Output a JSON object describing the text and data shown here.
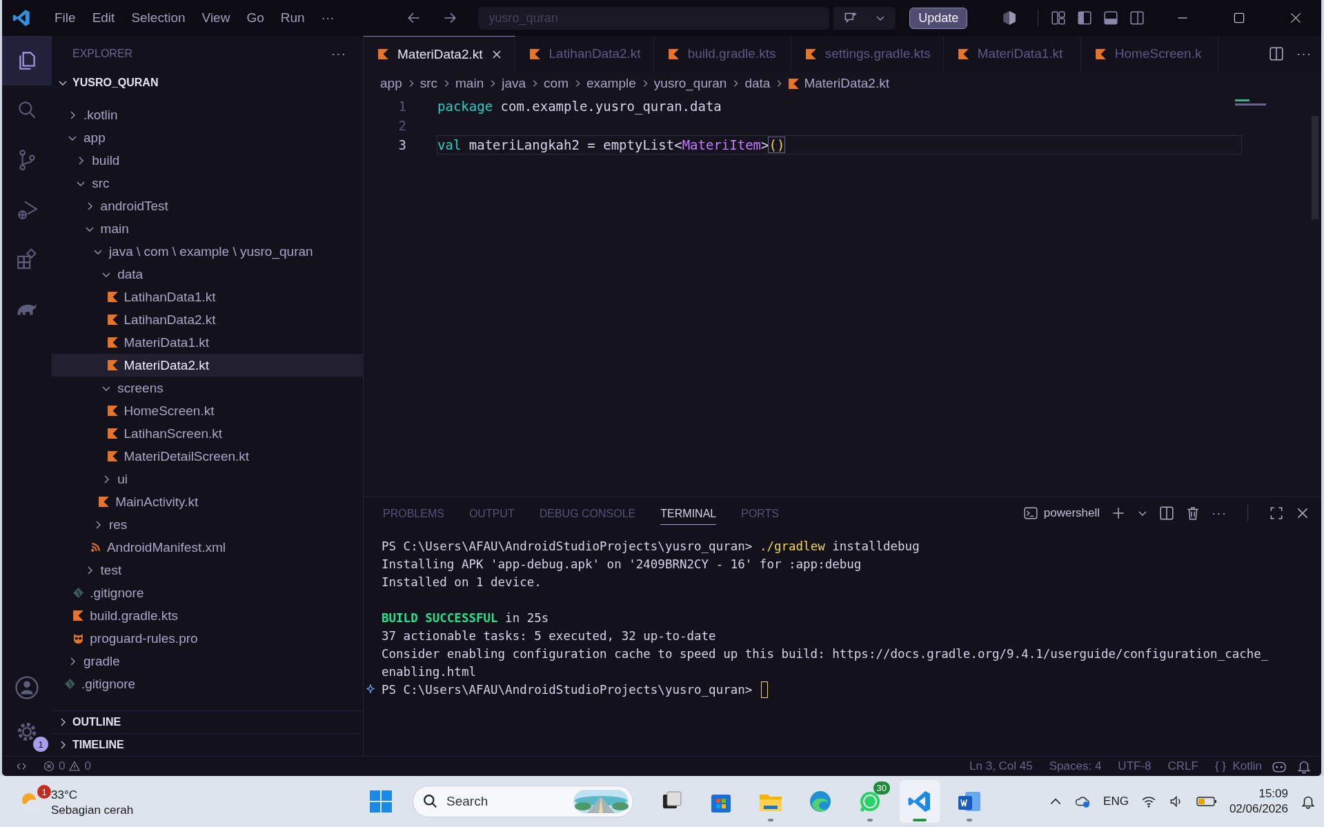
{
  "window": {
    "menu": [
      "File",
      "Edit",
      "Selection",
      "View",
      "Go",
      "Run",
      "···"
    ],
    "command_center": "yusro_quran",
    "update_button": "Update"
  },
  "activity_bar": {
    "items": [
      {
        "kind": "explorer",
        "selected": true
      },
      {
        "kind": "search",
        "selected": false
      },
      {
        "kind": "source-control",
        "selected": false
      },
      {
        "kind": "run-debug",
        "selected": false
      },
      {
        "kind": "extensions",
        "selected": false
      },
      {
        "kind": "gradle",
        "selected": false
      }
    ],
    "settings_badge": "1"
  },
  "explorer": {
    "title": "EXPLORER",
    "more": "···",
    "root": {
      "label": "YUSRO_QURAN",
      "expanded": true
    },
    "tree": [
      {
        "label": ".kotlin",
        "kind": "folder",
        "expanded": false,
        "selected": false
      },
      {
        "label": "app",
        "kind": "folder",
        "expanded": true,
        "selected": false,
        "children": [
          {
            "label": "build",
            "kind": "folder",
            "expanded": false,
            "selected": false
          },
          {
            "label": "src",
            "kind": "folder",
            "expanded": true,
            "selected": false,
            "children": [
              {
                "label": "androidTest",
                "kind": "folder",
                "expanded": false,
                "selected": false
              },
              {
                "label": "main",
                "kind": "folder",
                "expanded": true,
                "selected": false,
                "children": [
                  {
                    "label": "java \\ com \\ example \\ yusro_quran",
                    "kind": "folder",
                    "expanded": true,
                    "selected": false,
                    "children": [
                      {
                        "label": "data",
                        "kind": "folder",
                        "expanded": true,
                        "selected": false,
                        "children": [
                          {
                            "label": "LatihanData1.kt",
                            "kind": "kotlin",
                            "selected": false
                          },
                          {
                            "label": "LatihanData2.kt",
                            "kind": "kotlin",
                            "selected": false
                          },
                          {
                            "label": "MateriData1.kt",
                            "kind": "kotlin",
                            "selected": false
                          },
                          {
                            "label": "MateriData2.kt",
                            "kind": "kotlin",
                            "selected": true
                          }
                        ]
                      },
                      {
                        "label": "screens",
                        "kind": "folder",
                        "expanded": true,
                        "selected": false,
                        "children": [
                          {
                            "label": "HomeScreen.kt",
                            "kind": "kotlin",
                            "selected": false
                          },
                          {
                            "label": "LatihanScreen.kt",
                            "kind": "kotlin",
                            "selected": false
                          },
                          {
                            "label": "MateriDetailScreen.kt",
                            "kind": "kotlin",
                            "selected": false
                          }
                        ]
                      },
                      {
                        "label": "ui",
                        "kind": "folder",
                        "expanded": false,
                        "selected": false
                      },
                      {
                        "label": "MainActivity.kt",
                        "kind": "kotlin",
                        "selected": false
                      }
                    ]
                  },
                  {
                    "label": "res",
                    "kind": "folder",
                    "expanded": false,
                    "selected": false
                  },
                  {
                    "label": "AndroidManifest.xml",
                    "kind": "xml",
                    "selected": false
                  }
                ]
              },
              {
                "label": "test",
                "kind": "folder",
                "expanded": false,
                "selected": false
              }
            ]
          },
          {
            "label": ".gitignore",
            "kind": "git",
            "selected": false
          },
          {
            "label": "build.gradle.kts",
            "kind": "kotlin",
            "selected": false
          },
          {
            "label": "proguard-rules.pro",
            "kind": "proguard",
            "selected": false
          }
        ]
      },
      {
        "label": "gradle",
        "kind": "folder",
        "expanded": false,
        "selected": false
      },
      {
        "label": ".gitignore",
        "kind": "git",
        "selected": false
      }
    ],
    "sections": [
      {
        "label": "OUTLINE",
        "expanded": false
      },
      {
        "label": "TIMELINE",
        "expanded": false
      }
    ]
  },
  "editor": {
    "tabs": [
      {
        "label": "MateriData2.kt",
        "selected": true
      },
      {
        "label": "LatihanData2.kt",
        "selected": false
      },
      {
        "label": "build.gradle.kts",
        "selected": false
      },
      {
        "label": "settings.gradle.kts",
        "selected": false
      },
      {
        "label": "MateriData1.kt",
        "selected": false
      },
      {
        "label": "HomeScreen.k",
        "selected": false
      }
    ],
    "tab_more": "···",
    "breadcrumb": [
      "app",
      "src",
      "main",
      "java",
      "com",
      "example",
      "yusro_quran",
      "data",
      "MateriData2.kt"
    ],
    "lines": [
      {
        "number": "1",
        "selected": false,
        "tokens": [
          {
            "text": "package",
            "kind": "keyword"
          },
          {
            "text": " com.example.yusro_quran.data",
            "kind": "plain"
          }
        ]
      },
      {
        "number": "2",
        "selected": false
      },
      {
        "number": "3",
        "selected": true,
        "tokens": [
          {
            "text": "val",
            "kind": "keyword"
          },
          {
            "text": " materiLangkah2 = emptyList<",
            "kind": "plain"
          },
          {
            "text": "MateriItem",
            "kind": "type"
          },
          {
            "text": ">",
            "kind": "plain"
          },
          {
            "text": "()",
            "kind": "bracket"
          }
        ]
      }
    ]
  },
  "panel": {
    "tabs": [
      {
        "label": "PROBLEMS",
        "selected": false
      },
      {
        "label": "OUTPUT",
        "selected": false
      },
      {
        "label": "DEBUG CONSOLE",
        "selected": false
      },
      {
        "label": "TERMINAL",
        "selected": true
      },
      {
        "label": "PORTS",
        "selected": false
      }
    ],
    "shell": "powershell",
    "more": "···",
    "terminal": [
      {
        "kind": "output",
        "segments": [
          {
            "text": "PS C:\\Users\\AFAU\\AndroidStudioProjects\\yusro_quran> ",
            "kind": "plain"
          },
          {
            "text": "./gradlew",
            "kind": "command"
          },
          {
            "text": " installdebug",
            "kind": "plain"
          }
        ]
      },
      {
        "kind": "output",
        "segments": [
          {
            "text": "Installing APK 'app-debug.apk' on '2409BRN2CY - 16' for :app:debug",
            "kind": "plain"
          }
        ]
      },
      {
        "kind": "output",
        "segments": [
          {
            "text": "Installed on 1 device.",
            "kind": "plain"
          }
        ]
      },
      {
        "kind": "blank"
      },
      {
        "kind": "output",
        "segments": [
          {
            "text": "BUILD SUCCESSFUL",
            "kind": "success"
          },
          {
            "text": " in 25s",
            "kind": "plain"
          }
        ]
      },
      {
        "kind": "output",
        "segments": [
          {
            "text": "37 actionable tasks: 5 executed, 32 up-to-date",
            "kind": "plain"
          }
        ]
      },
      {
        "kind": "output",
        "segments": [
          {
            "text": "Consider enabling configuration cache to speed up this build: https://docs.gradle.org/9.4.1/userguide/configuration_cache_",
            "kind": "plain"
          }
        ]
      },
      {
        "kind": "output",
        "segments": [
          {
            "text": "enabling.html",
            "kind": "plain"
          }
        ]
      },
      {
        "kind": "prompt",
        "segments": [
          {
            "text": "PS C:\\Users\\AFAU\\AndroidStudioProjects\\yusro_quran> ",
            "kind": "plain"
          }
        ]
      }
    ]
  },
  "status_bar": {
    "errors": "0",
    "warnings": "0",
    "items": [
      "Ln 3, Col 45",
      "Spaces: 4",
      "UTF-8",
      "CRLF"
    ],
    "language_icon": "{ }",
    "language": "Kotlin"
  },
  "taskbar": {
    "weather": {
      "temp": "33°C",
      "condition": "Sebagian cerah",
      "badge": "1"
    },
    "search_placeholder": "Search",
    "apps": [
      {
        "kind": "task-view",
        "running": false,
        "selected": false
      },
      {
        "kind": "store",
        "running": false,
        "selected": false
      },
      {
        "kind": "files",
        "running": true,
        "selected": false
      },
      {
        "kind": "edge",
        "running": false,
        "selected": false
      },
      {
        "kind": "whatsapp",
        "running": true,
        "selected": false,
        "badge": "30"
      },
      {
        "kind": "vscode",
        "running": true,
        "selected": true
      },
      {
        "kind": "word",
        "running": true,
        "selected": false
      }
    ],
    "tray": {
      "language": "ENG",
      "time": "15:09",
      "date": "02/06/2026"
    }
  }
}
